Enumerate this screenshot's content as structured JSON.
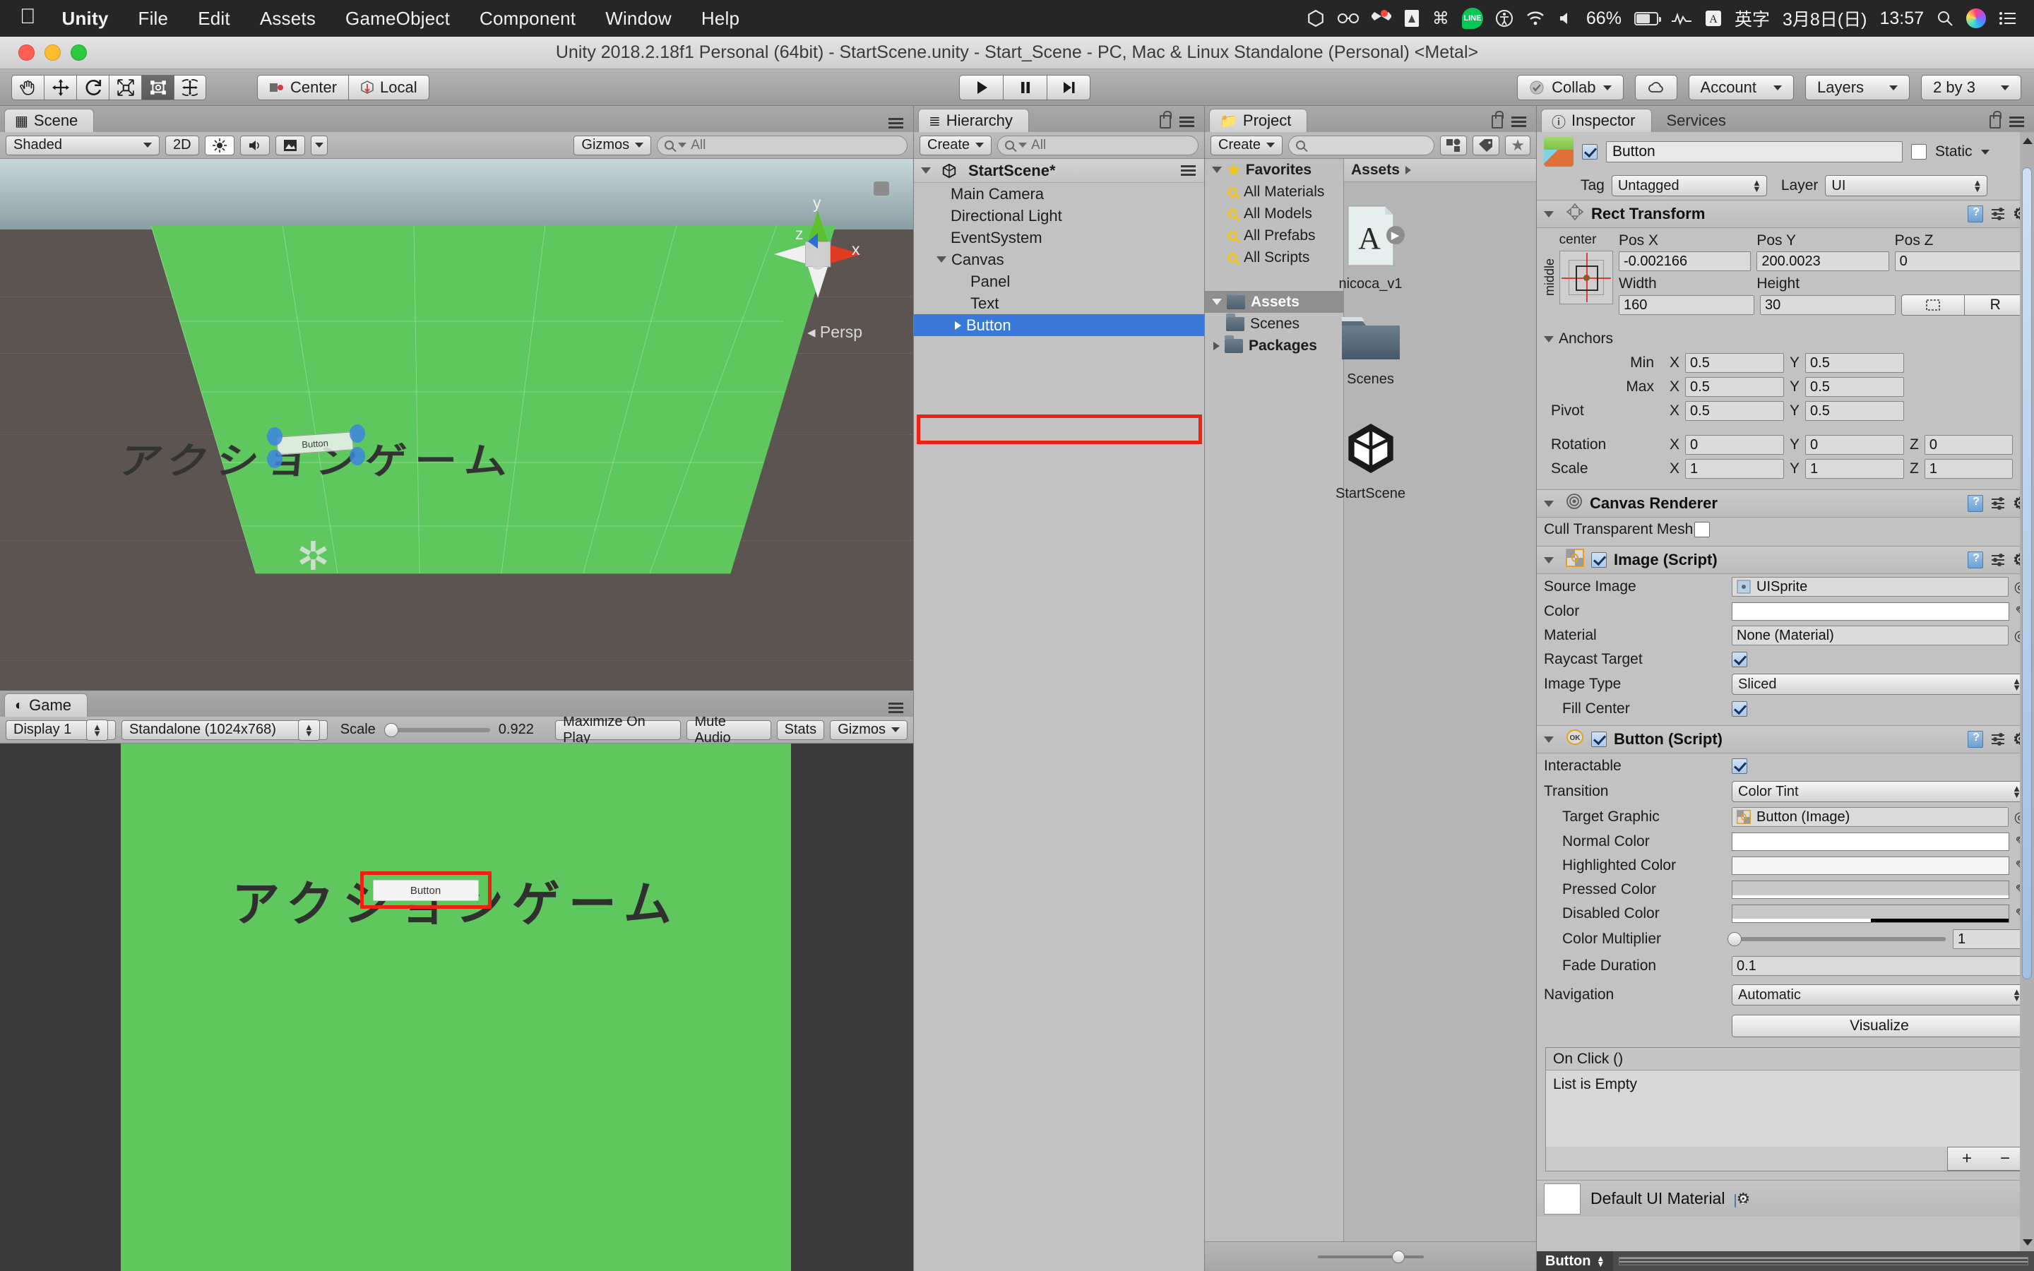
{
  "macmenu": {
    "apple": "apple-logo",
    "items": [
      "Unity",
      "File",
      "Edit",
      "Assets",
      "GameObject",
      "Component",
      "Window",
      "Help"
    ],
    "status": {
      "battery_percent": "66%",
      "input_mode_icon": "A",
      "input_mode": "英字",
      "date": "3月8日(日)",
      "time": "13:57",
      "line_badge": "LINE",
      "icons": [
        "unity-icon",
        "glasses-icon",
        "dropbox-icon",
        "preview-icon",
        "command-icon",
        "line-icon",
        "accessibility-icon",
        "wifi-icon",
        "volume-icon",
        "battery-icon",
        "activity-icon",
        "spotlight-icon",
        "siri-icon",
        "control-center-icon"
      ]
    }
  },
  "window": {
    "title": "Unity 2018.2.18f1 Personal (64bit) - StartScene.unity - Start_Scene - PC, Mac & Linux Standalone (Personal) <Metal>"
  },
  "toolbar": {
    "tools": [
      "hand-tool",
      "move-tool",
      "rotate-tool",
      "scale-tool",
      "rect-tool",
      "transform-tool"
    ],
    "active_tool_index": 4,
    "pivot_mode": "Center",
    "handle_space": "Local",
    "play": "play-button",
    "pause": "pause-button",
    "step": "step-button",
    "collab": "Collab",
    "cloud": "cloud-button",
    "account": "Account",
    "layers": "Layers",
    "layout": "2 by 3"
  },
  "scene": {
    "tab": "Scene",
    "shading": "Shaded",
    "mode2d": "2D",
    "lighting_icon": "sun-icon",
    "audio_icon": "audio-icon",
    "fx_icon": "image-fx-icon",
    "gizmos": "Gizmos",
    "search_placeholder": "All",
    "title_text": "アクションゲーム",
    "button_label": "Button",
    "gizmo_axes": {
      "y": "y",
      "z": "z",
      "x": "x"
    },
    "projection": "Persp"
  },
  "game": {
    "tab": "Game",
    "display": "Display 1",
    "aspect": "Standalone (1024x768)",
    "scale_label": "Scale",
    "scale_value": "0.922",
    "maximize": "Maximize On Play",
    "mute": "Mute Audio",
    "stats": "Stats",
    "gizmos": "Gizmos",
    "title_text": "アクションゲーム",
    "button_label": "Button"
  },
  "hierarchy": {
    "tab": "Hierarchy",
    "create": "Create",
    "search_placeholder": "All",
    "scene_name": "StartScene*",
    "items": [
      {
        "label": "Main Camera",
        "depth": 1,
        "expandable": false,
        "selected": false
      },
      {
        "label": "Directional Light",
        "depth": 1,
        "expandable": false,
        "selected": false
      },
      {
        "label": "EventSystem",
        "depth": 1,
        "expandable": false,
        "selected": false
      },
      {
        "label": "Canvas",
        "depth": 1,
        "expandable": true,
        "expanded": true,
        "selected": false
      },
      {
        "label": "Panel",
        "depth": 2,
        "expandable": false,
        "selected": false
      },
      {
        "label": "Text",
        "depth": 2,
        "expandable": false,
        "selected": false
      },
      {
        "label": "Button",
        "depth": 2,
        "expandable": true,
        "expanded": false,
        "selected": true
      }
    ]
  },
  "project": {
    "tab": "Project",
    "create": "Create",
    "search_placeholder": "",
    "favorites": "Favorites",
    "favorite_items": [
      "All Materials",
      "All Models",
      "All Prefabs",
      "All Scripts"
    ],
    "tree": [
      {
        "label": "Assets",
        "selected": true
      },
      {
        "label": "Scenes",
        "selected": false
      },
      {
        "label": "Packages",
        "selected": false
      }
    ],
    "breadcrumb": "Assets",
    "assets": [
      {
        "name": "nicoca_v1",
        "icon": "font-asset-icon"
      },
      {
        "name": "Scenes",
        "icon": "folder-icon"
      },
      {
        "name": "StartScene",
        "icon": "unity-scene-icon"
      }
    ]
  },
  "inspector": {
    "tabs": [
      "Inspector",
      "Services"
    ],
    "active_tab": "Inspector",
    "object_name": "Button",
    "enabled": true,
    "static_label": "Static",
    "tag_label": "Tag",
    "tag_value": "Untagged",
    "layer_label": "Layer",
    "layer_value": "UI",
    "rect_transform": {
      "title": "Rect Transform",
      "anchor_preset_top": "center",
      "anchor_preset_side": "middle",
      "pos_labels": [
        "Pos X",
        "Pos Y",
        "Pos Z"
      ],
      "pos_values": [
        "-0.002166",
        "200.0023",
        "0"
      ],
      "size_labels": [
        "Width",
        "Height"
      ],
      "size_values": [
        "160",
        "30"
      ],
      "blueprint_btn": "blueprint-mode",
      "raw_btn": "R",
      "anchors_label": "Anchors",
      "min_label": "Min",
      "min_x": "0.5",
      "min_y": "0.5",
      "max_label": "Max",
      "max_x": "0.5",
      "max_y": "0.5",
      "pivot_label": "Pivot",
      "pivot_x": "0.5",
      "pivot_y": "0.5",
      "rotation_label": "Rotation",
      "rot_x": "0",
      "rot_y": "0",
      "rot_z": "0",
      "scale_label": "Scale",
      "scale_x": "1",
      "scale_y": "1",
      "scale_z": "1",
      "axis_x": "X",
      "axis_y": "Y",
      "axis_z": "Z"
    },
    "canvas_renderer": {
      "title": "Canvas Renderer",
      "cull_label": "Cull Transparent Mesh",
      "cull_checked": false
    },
    "image_script": {
      "title": "Image (Script)",
      "enabled": true,
      "source_image_label": "Source Image",
      "source_image_value": "UISprite",
      "color_label": "Color",
      "color_value": "#FFFFFF",
      "material_label": "Material",
      "material_value": "None (Material)",
      "raycast_label": "Raycast Target",
      "raycast_checked": true,
      "image_type_label": "Image Type",
      "image_type_value": "Sliced",
      "fill_center_label": "Fill Center",
      "fill_center_checked": true
    },
    "button_script": {
      "title": "Button (Script)",
      "enabled": true,
      "interactable_label": "Interactable",
      "interactable_checked": true,
      "transition_label": "Transition",
      "transition_value": "Color Tint",
      "target_graphic_label": "Target Graphic",
      "target_graphic_value": "Button (Image)",
      "normal_color_label": "Normal Color",
      "normal_color_value": "#FFFFFF",
      "highlighted_color_label": "Highlighted Color",
      "highlighted_color_value": "#F5F5F5",
      "pressed_color_label": "Pressed Color",
      "pressed_color_value": "#C8C8C8",
      "disabled_color_label": "Disabled Color",
      "disabled_color_value": "#C8C8C8",
      "color_multiplier_label": "Color Multiplier",
      "color_multiplier_value": "1",
      "fade_duration_label": "Fade Duration",
      "fade_duration_value": "0.1",
      "navigation_label": "Navigation",
      "navigation_value": "Automatic",
      "visualize_label": "Visualize",
      "onclick_label": "On Click ()",
      "list_empty_label": "List is Empty",
      "add_btn": "+",
      "remove_btn": "−"
    },
    "material": {
      "title": "Default UI Material"
    },
    "footer_tag": "Button"
  },
  "colors": {
    "accent_selection": "#3879D9",
    "annotation_red": "#F22012",
    "scene_green": "#5EC75E",
    "panel_bg": "#C2C2C2"
  }
}
